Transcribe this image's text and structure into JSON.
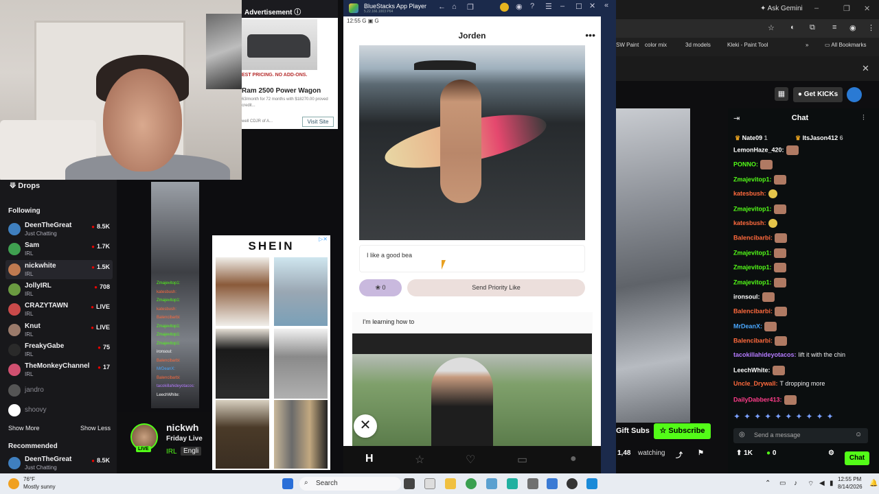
{
  "sidebar": {
    "drops": "Drops",
    "following": "Following",
    "channels": [
      {
        "name": "DeenTheGreat",
        "sub": "Just Chatting",
        "viewers": "8.5K",
        "color": "#3f7fbf"
      },
      {
        "name": "Sam",
        "sub": "IRL",
        "viewers": "1.7K",
        "color": "#3fa050"
      },
      {
        "name": "nickwhite",
        "sub": "IRL",
        "viewers": "1.5K",
        "color": "#c07a50"
      },
      {
        "name": "JollyIRL",
        "sub": "IRL",
        "viewers": "708",
        "color": "#6a9a40"
      },
      {
        "name": "CRAZYTAWN",
        "sub": "IRL",
        "viewers": "LIVE",
        "color": "#c94a4a"
      },
      {
        "name": "Knut",
        "sub": "IRL",
        "viewers": "LIVE",
        "color": "#9a7a6a"
      },
      {
        "name": "FreakyGabe",
        "sub": "IRL",
        "viewers": "75",
        "color": "#2a2a2a"
      },
      {
        "name": "TheMonkeyChannel",
        "sub": "IRL",
        "viewers": "17",
        "color": "#d05070"
      }
    ],
    "offline": [
      {
        "name": "jandro"
      },
      {
        "name": "shoovy"
      }
    ],
    "show_more": "Show More",
    "show_less": "Show Less",
    "recommended": "Recommended",
    "rec": {
      "name": "DeenTheGreat",
      "sub": "Just Chatting",
      "viewers": "8.5K"
    }
  },
  "ad": {
    "header": "Advertisement",
    "banner": "EST PRICING. NO ADD-ONS.",
    "title": "Ram 2500 Power Wagon",
    "details": "63/month for 72 months with $18270.00 proved credit...",
    "dealer": "well CDJR of A...",
    "visit": "Visit Site"
  },
  "shein": {
    "logo": "SHEIN"
  },
  "stream_info": {
    "name": "nickwh",
    "sub": "Friday Live",
    "tag1": "IRL",
    "tag2": "Engli",
    "live": "LIVE"
  },
  "bluestacks": {
    "title": "BlueStacks App Player",
    "version": "5.22.166.1003 P64",
    "time": "12:55",
    "status_icons": "G ▣ G",
    "profile_name": "Jorden",
    "input_text": "I like a good bea",
    "rose_count": "0",
    "priority_like": "Send Priority Like",
    "prompt": "I'm learning how to"
  },
  "chrome": {
    "ask_gemini": "Ask Gemini",
    "bookmarks": [
      "SW Paint",
      "color mix",
      "3d models",
      "Kleki - Paint Tool"
    ],
    "all_bookmarks": "All Bookmarks"
  },
  "kick": {
    "get_kicks": "Get KICKs",
    "chat_title": "Chat",
    "gifters": [
      {
        "name": "Nate09",
        "count": "1"
      },
      {
        "name": "ItsJason412",
        "count": "6"
      }
    ],
    "messages": [
      {
        "user": "LemonHaze_420:",
        "color": "#ffffff",
        "text": ""
      },
      {
        "user": "PONNO:",
        "color": "#53fc18",
        "text": ""
      },
      {
        "user": "Zmajevitop1:",
        "color": "#53fc18",
        "text": ""
      },
      {
        "user": "katesbush:",
        "color": "#ff6a3d",
        "text": ""
      },
      {
        "user": "Zmajevitop1:",
        "color": "#53fc18",
        "text": ""
      },
      {
        "user": "katesbush:",
        "color": "#ff6a3d",
        "text": ""
      },
      {
        "user": "Balencibarbi:",
        "color": "#ff6a3d",
        "text": ""
      },
      {
        "user": "Zmajevitop1:",
        "color": "#53fc18",
        "text": ""
      },
      {
        "user": "Zmajevitop1:",
        "color": "#53fc18",
        "text": ""
      },
      {
        "user": "Zmajevitop1:",
        "color": "#53fc18",
        "text": ""
      },
      {
        "user": "ironsoul:",
        "color": "#ffffff",
        "text": ""
      },
      {
        "user": "Balencibarbi:",
        "color": "#ff6a3d",
        "text": ""
      },
      {
        "user": "MrDeanX:",
        "color": "#4aa8ff",
        "text": ""
      },
      {
        "user": "Balencibarbi:",
        "color": "#ff6a3d",
        "text": ""
      },
      {
        "user": "tacokillahideyotacos:",
        "color": "#b57bff",
        "text": "lift it with the chin"
      },
      {
        "user": "LeechWhite:",
        "color": "#ffffff",
        "text": ""
      },
      {
        "user": "Uncle_Drywall:",
        "color": "#ff6a3d",
        "text": "T dropping more"
      },
      {
        "user": "DailyDabber413:",
        "color": "#ff3d8a",
        "text": ""
      }
    ],
    "gift_subs": "Gift Subs",
    "subscribe": "Subscribe",
    "send_placeholder": "Send a message",
    "viewers": "1,48",
    "watching": "watching",
    "likes": "1K",
    "zero": "0",
    "chat_btn": "Chat"
  },
  "taskbar": {
    "weather_temp": "76°F",
    "weather_desc": "Mostly sunny",
    "search": "Search",
    "time": "12:55 PM",
    "date": "8/14/2026"
  }
}
